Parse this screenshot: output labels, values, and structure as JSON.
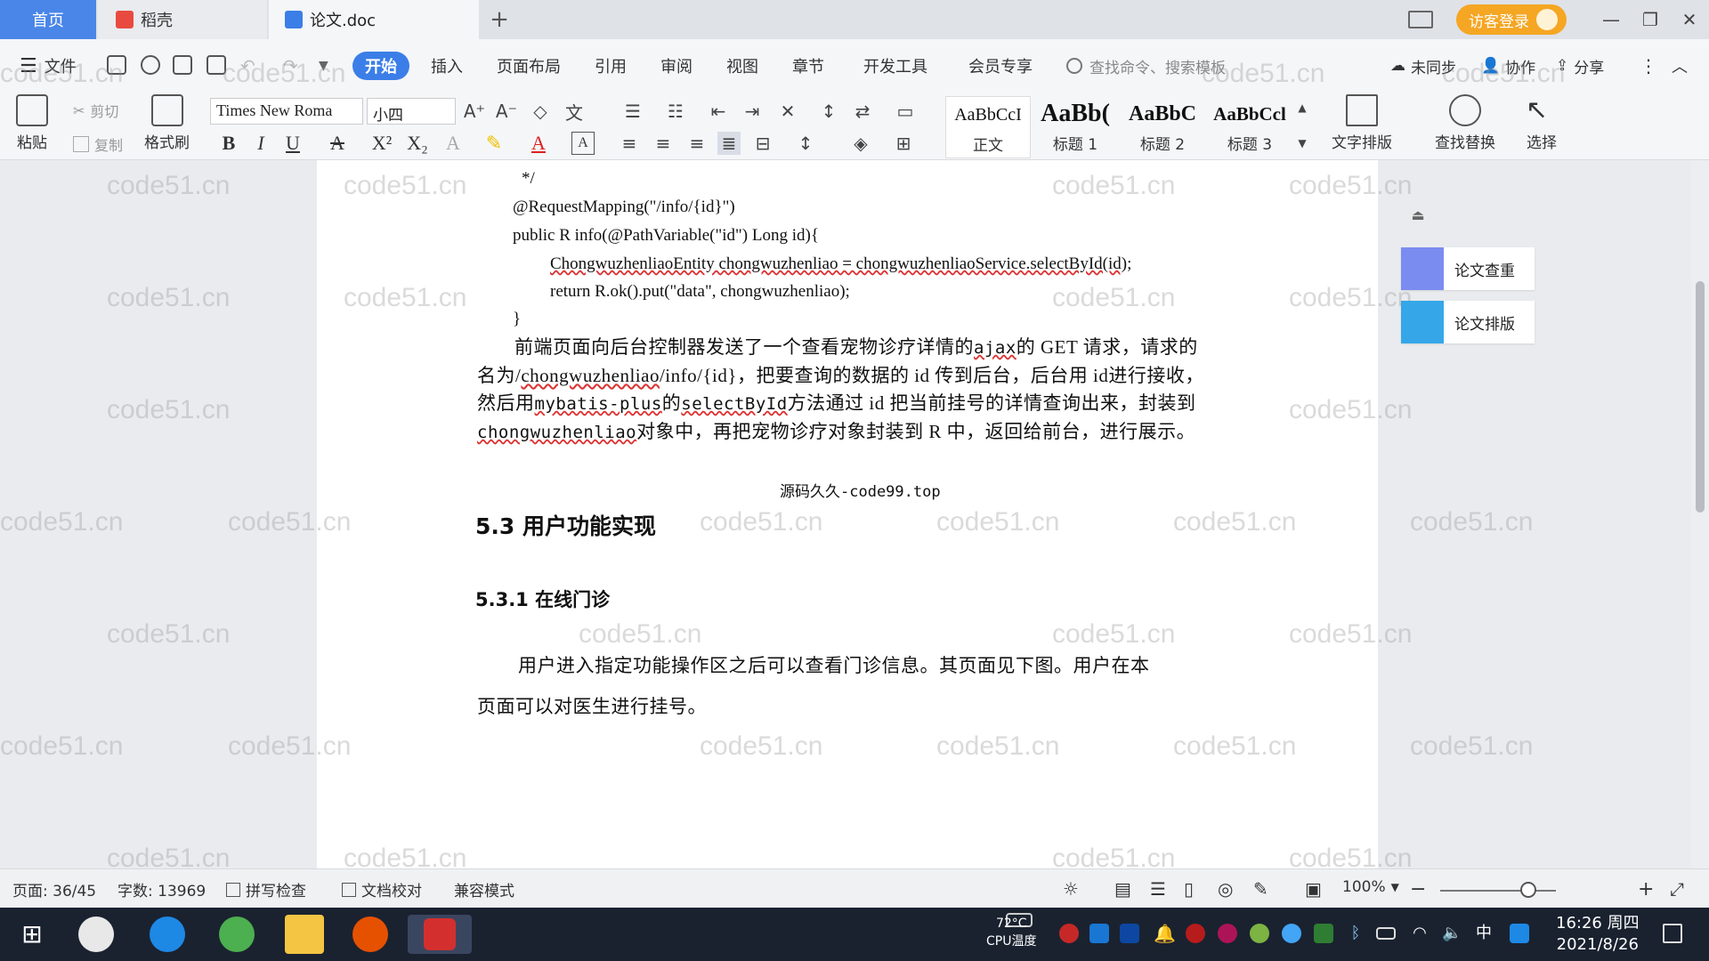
{
  "tabs": {
    "home": "首页",
    "daoke": "稻壳",
    "doc": "论文.doc"
  },
  "titlebar": {
    "guest_login": "访客登录"
  },
  "menu": {
    "file": "文件",
    "start": "开始",
    "insert": "插入",
    "layout": "页面布局",
    "reference": "引用",
    "review": "审阅",
    "view": "视图",
    "chapter": "章节",
    "devtools": "开发工具",
    "member": "会员专享",
    "search_placeholder": "查找命令、搜索模板",
    "unsynced": "未同步",
    "collab": "协作",
    "share": "分享"
  },
  "ribbon": {
    "paste": "粘贴",
    "cut": "剪切",
    "copy": "复制",
    "format_painter": "格式刷",
    "font_name": "Times New Roma",
    "font_size": "小四",
    "styles": [
      {
        "preview": "AaBbCcI",
        "label": "正文"
      },
      {
        "preview": "AaBb(",
        "label": "标题 1"
      },
      {
        "preview": "AaBbC",
        "label": "标题 2"
      },
      {
        "preview": "AaBbCcl",
        "label": "标题 3"
      }
    ],
    "text_layout": "文字排版",
    "find_replace": "查找替换",
    "select": "选择"
  },
  "document": {
    "code": [
      "*/",
      "@RequestMapping(\"/info/{id}\")",
      "public R info(@PathVariable(\"id\") Long id){",
      "ChongwuzhenliaoEntity chongwuzhenliao = chongwuzhenliaoService.selectById(id);",
      "return R.ok().put(\"data\", chongwuzhenliao);",
      "}"
    ],
    "paragraph1": {
      "p1": "前端页面向后台控制器发送了一个查看宠物诊疗详情的",
      "ajax": "ajax",
      "p2": "的 GET 请求，请",
      "p3": "求的名为/",
      "path": "chongwuzhenliao",
      "p4": "/info/{id}，把要查询的数据的 id 传到后台，后台用 id",
      "p5": "进行接收，然后用",
      "mp": "mybatis-plus",
      "p6": "的",
      "sel": "selectById",
      "p7": "方法通过 id 把当前挂号的详情",
      "p8": "查询出来，封装到",
      "ent": "chongwuzhenliao",
      "p9": "对象中，再把宠物诊疗对象封装到 R 中，返",
      "p10": "回给前台，进行展示。"
    },
    "caption": "源码久久-code99.top",
    "h2": "5.3  用户功能实现",
    "h3": "5.3.1  在线门诊",
    "paragraph2_line1": "用户进入指定功能操作区之后可以查看门诊信息。其页面见下图。用户在本",
    "paragraph2_line2": "页面可以对医生进行挂号。",
    "watermark": "code51.cn"
  },
  "sidepanel": {
    "check": "论文查重",
    "layout": "论文排版"
  },
  "statusbar": {
    "page": "页面: 36/45",
    "words": "字数: 13969",
    "spell": "拼写检查",
    "proof": "文档校对",
    "compat": "兼容模式",
    "zoom": "100%",
    "zoom_level": 1.0
  },
  "taskbar": {
    "cpu_temp": "72°C",
    "cpu_label": "CPU温度",
    "ime": "中",
    "time": "16:26 周四",
    "date": "2021/8/26"
  }
}
